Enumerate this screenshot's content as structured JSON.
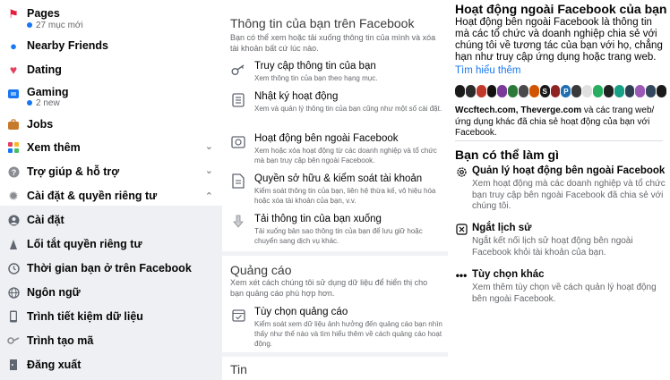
{
  "sidebar": {
    "items": [
      {
        "label": "Pages",
        "sub": "27 mục mới",
        "icon": "flag-icon"
      },
      {
        "label": "Nearby Friends",
        "icon": "location-icon"
      },
      {
        "label": "Dating",
        "icon": "heart-icon"
      },
      {
        "label": "Gaming",
        "sub": "2 new",
        "icon": "gaming-icon"
      },
      {
        "label": "Jobs",
        "icon": "briefcase-icon"
      },
      {
        "label": "Xem thêm",
        "icon": "grid-icon"
      },
      {
        "label": "Trợ giúp & hỗ trợ",
        "icon": "help-icon"
      },
      {
        "label": "Cài đặt & quyền riêng tư",
        "icon": "gear-icon"
      },
      {
        "label": "Cài đặt",
        "icon": "user-settings-icon"
      },
      {
        "label": "Lối tắt quyền riêng tư",
        "icon": "lock-icon"
      },
      {
        "label": "Thời gian bạn ở trên Facebook",
        "icon": "clock-icon"
      },
      {
        "label": "Ngôn ngữ",
        "icon": "globe-icon"
      },
      {
        "label": "Trình tiết kiệm dữ liệu",
        "icon": "phone-icon"
      },
      {
        "label": "Trình tạo mã",
        "icon": "key-icon"
      },
      {
        "label": "Đăng xuất",
        "icon": "logout-icon"
      }
    ]
  },
  "middle": {
    "info_title": "Thông tin của bạn trên Facebook",
    "info_desc": "Bạn có thể xem hoặc tải xuống thông tin của mình và xóa tài khoản bất cứ lúc nào.",
    "options": [
      {
        "title": "Truy cập thông tin của bạn",
        "desc": "Xem thông tin của bạn theo hạng mục.",
        "icon": "key-icon"
      },
      {
        "title": "Nhật ký hoạt động",
        "desc": "Xem và quản lý thông tin của bạn cũng như một số cài đặt.",
        "icon": "list-icon"
      },
      {
        "title": "Hoạt động bên ngoài Facebook",
        "desc": "Xem hoặc xóa hoạt động từ các doanh nghiệp và tổ chức mà bạn truy cập bên ngoài Facebook.",
        "icon": "off-facebook-icon"
      },
      {
        "title": "Quyền sở hữu & kiểm soát tài khoản",
        "desc": "Kiểm soát thông tin của bạn, liên hệ thừa kế, vô hiệu hóa hoặc xóa tài khoản của bạn, v.v.",
        "icon": "document-icon"
      },
      {
        "title": "Tải thông tin của bạn xuống",
        "desc": "Tải xuống bản sao thông tin của bạn để lưu giữ hoặc chuyển sang dịch vụ khác.",
        "icon": "download-icon"
      }
    ],
    "ads_title": "Quảng cáo",
    "ads_desc": "Xem xét cách chúng tôi sử dụng dữ liệu để hiển thị cho bạn quảng cáo phù hợp hơn.",
    "ads_option": {
      "title": "Tùy chọn quảng cáo",
      "desc": "Kiểm soát xem dữ liệu ảnh hưởng đến quảng cáo bạn nhìn thấy như thế nào và tìm hiểu thêm về cách quảng cáo hoạt động.",
      "icon": "calendar-check-icon"
    },
    "news_title": "Tin"
  },
  "right": {
    "title": "Hoạt động ngoài Facebook của bạn",
    "desc": "Hoạt động bên ngoài Facebook là thông tin mà các tổ chức và doanh nghiệp chia sẻ với chúng tôi về tương tác của bạn với họ, chẳng hạn như truy cập ứng dụng hoặc trang web.",
    "learn_more": "Tìm hiểu thêm",
    "sites": "Wccftech.com, Theverge.com và các trang web/ ứng dụng khác đã chia sẻ hoạt động của bạn với Facebook.",
    "sites_bold": "Wccftech.com, Theverge.com",
    "sites_rest": " và các trang web/ ứng dụng khác đã chia sẻ hoạt động của bạn với Facebook.",
    "can_do_title": "Bạn có thể làm gì",
    "actions": [
      {
        "title": "Quản lý hoạt động bên ngoài Facebook",
        "desc": "Xem hoạt động mà các doanh nghiệp và tổ chức bạn truy cập bên ngoài Facebook đã chia sẻ với chúng tôi.",
        "icon": "gear-icon"
      },
      {
        "title": "Ngắt lịch sử",
        "desc": "Ngắt kết nối lịch sử hoạt động bên ngoài Facebook khỏi tài khoản của bạn.",
        "icon": "close-box-icon"
      },
      {
        "title": "Tùy chọn khác",
        "desc": "Xem thêm tùy chọn về cách quản lý hoạt động bên ngoài Facebook.",
        "icon": "more-icon"
      }
    ],
    "logo_colors": [
      "#1a1a1a",
      "#2b2b2b",
      "#c0392b",
      "#111111",
      "#7a3a9a",
      "#2c7a3a",
      "#4a4a4a",
      "#d35400",
      "#1a1a1a",
      "#8e2424",
      "#1f6fb2",
      "#3a3a3a",
      "#e0e0e0",
      "#27ae60",
      "#222222",
      "#16a085",
      "#2c3e50",
      "#9b59b6",
      "#34495e",
      "#1a1a1a"
    ],
    "logo_letters": [
      "",
      "",
      "",
      "",
      "",
      "",
      "",
      "",
      "S",
      "",
      "P",
      "",
      "",
      "",
      "",
      "",
      "",
      "",
      "",
      ""
    ]
  },
  "colors": {
    "accent": "#1877f2",
    "muted": "#65676b",
    "panel": "#f0f2f5"
  }
}
